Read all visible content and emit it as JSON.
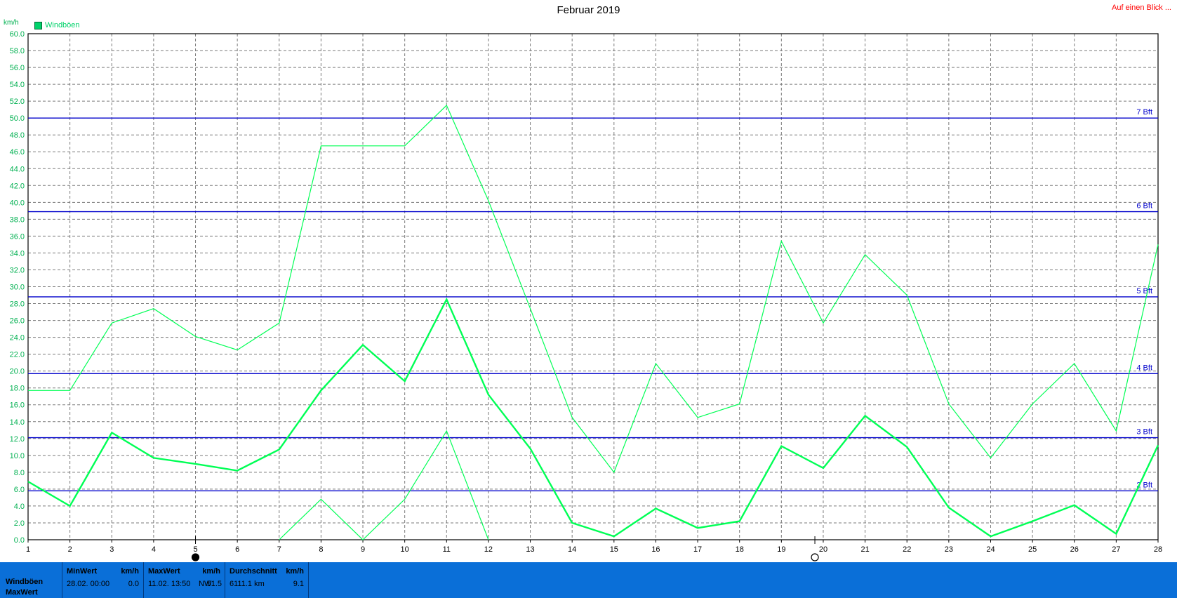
{
  "chart_data": {
    "type": "line",
    "title": "Februar 2019",
    "ylabel": "km/h",
    "ylim": [
      0,
      60
    ],
    "y_tick_step": 2,
    "x_ticks": [
      1,
      2,
      3,
      4,
      5,
      6,
      7,
      8,
      9,
      10,
      11,
      12,
      13,
      14,
      15,
      16,
      17,
      18,
      19,
      20,
      21,
      22,
      23,
      24,
      25,
      26,
      27,
      28
    ],
    "grid": true,
    "legend": "top-left",
    "series": [
      {
        "name": "Windböen",
        "role": "max",
        "color": "#00ff55",
        "values": [
          17.7,
          17.7,
          25.7,
          27.4,
          24.1,
          22.5,
          25.7,
          46.7,
          46.7,
          46.7,
          51.5,
          40.2,
          27.4,
          14.5,
          8.0,
          20.9,
          14.5,
          16.1,
          35.4,
          25.7,
          33.8,
          29.0,
          16.1,
          9.7,
          16.1,
          20.9,
          12.9,
          35.0
        ]
      },
      {
        "name": "",
        "role": "mean",
        "color": "#00ff55",
        "values": [
          6.9,
          4.0,
          12.7,
          9.7,
          9.0,
          8.2,
          10.7,
          17.7,
          23.1,
          18.8,
          28.5,
          17.2,
          10.8,
          2.0,
          0.4,
          3.7,
          1.4,
          2.2,
          11.1,
          8.5,
          14.7,
          11.0,
          3.8,
          0.4,
          2.2,
          4.1,
          0.7,
          11.2
        ]
      },
      {
        "name": "",
        "role": "min",
        "color": "#00ff55",
        "values": [
          null,
          null,
          null,
          null,
          null,
          null,
          0.0,
          4.8,
          0.0,
          4.8,
          12.9,
          0.0,
          null,
          null,
          null,
          null,
          null,
          null,
          null,
          null,
          null,
          null,
          null,
          null,
          null,
          null,
          null,
          null
        ]
      }
    ],
    "reference_lines": [
      {
        "label": "2 Bft",
        "value": 5.8
      },
      {
        "label": "3 Bft",
        "value": 12.1
      },
      {
        "label": "4 Bft",
        "value": 19.7
      },
      {
        "label": "5 Bft",
        "value": 28.8
      },
      {
        "label": "6 Bft",
        "value": 38.9
      },
      {
        "label": "7 Bft",
        "value": 50.0
      }
    ],
    "moon_markers": [
      {
        "day": 5,
        "phase": "new",
        "icon": "new-moon-icon"
      },
      {
        "day": 19.8,
        "phase": "full",
        "icon": "full-moon-icon"
      }
    ]
  },
  "header": {
    "title": "Februar 2019",
    "link": "Auf einen Blick ...",
    "unit": "km/h",
    "legend_label": "Windböen"
  },
  "footer": {
    "row_label_1": "Windböen",
    "row_label_2": "MaxWert",
    "min": {
      "h1": "MinWert",
      "h2": "km/h",
      "date": "28.02.  00:00",
      "value": "0.0"
    },
    "max": {
      "h1": "MaxWert",
      "h2": "km/h",
      "date": "11.02.  13:50",
      "dir": "NW",
      "value": "51.5"
    },
    "avg": {
      "h1": "Durchschnitt",
      "h2": "km/h",
      "dist": "6111.1 km",
      "value": "9.1"
    }
  },
  "colors": {
    "series": "#00ff55",
    "reference": "#0000cc",
    "footer_bg": "#0a6fd8",
    "link": "#ff0000"
  }
}
